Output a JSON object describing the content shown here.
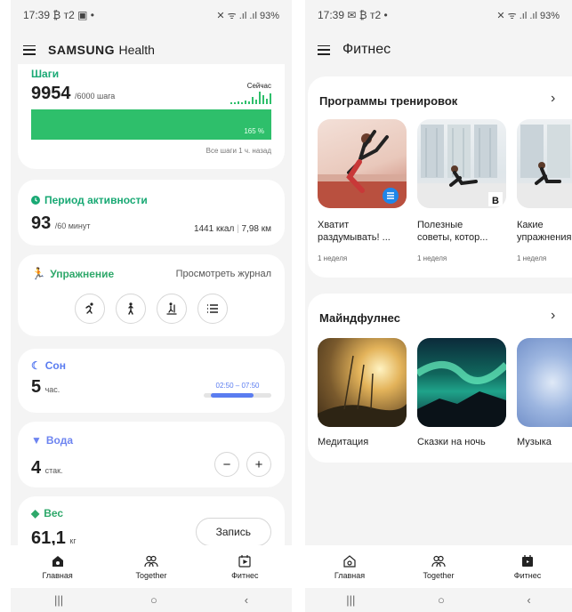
{
  "left": {
    "status": {
      "time": "17:39",
      "icons": "₿ т2 ▣ •",
      "right": "✕ ᯤ .ıl .ıl 93%"
    },
    "header": {
      "brand_bold": "SAMSUNG",
      "brand_light": "Health"
    },
    "steps": {
      "label": "Шаги",
      "value": "9954",
      "goal": "/6000 шага",
      "now_label": "Сейчас",
      "percent": "165 %",
      "footnote": "Все шаги 1 ч. назад"
    },
    "activity": {
      "label": "Период активности",
      "value": "93",
      "goal": "/60 минут",
      "kcal": "1441 ккал",
      "km": "7,98 км"
    },
    "exercise": {
      "label": "Упражнение",
      "journal": "Просмотреть журнал"
    },
    "sleep": {
      "label": "Сон",
      "value": "5",
      "unit": "час.",
      "range": "02:50 – 07:50"
    },
    "water": {
      "label": "Вода",
      "value": "4",
      "unit": "стак."
    },
    "weight": {
      "label": "Вес",
      "value": "61,1",
      "unit": "кг",
      "record": "Запись"
    },
    "nav": {
      "home": "Главная",
      "together": "Together",
      "fitness": "Фитнес"
    }
  },
  "right": {
    "status": {
      "time": "17:39",
      "icons": "✉ ₿ т2 •",
      "right": "✕ ᯤ .ıl .ıl 93%"
    },
    "header": {
      "title": "Фитнес"
    },
    "programs": {
      "title": "Программы тренировок",
      "items": [
        {
          "line1": "Хватит",
          "line2": "раздумывать! ...",
          "sub": "1 неделя"
        },
        {
          "line1": "Полезные",
          "line2": "советы, котор...",
          "sub": "1 неделя"
        },
        {
          "line1": "Какие",
          "line2": "упражнения",
          "sub": "1 неделя"
        }
      ]
    },
    "mindfulness": {
      "title": "Майндфулнес",
      "items": [
        {
          "label": "Медитация"
        },
        {
          "label": "Сказки на ночь"
        },
        {
          "label": "Музыка"
        }
      ]
    },
    "nav": {
      "home": "Главная",
      "together": "Together",
      "fitness": "Фитнес"
    }
  },
  "colors": {
    "accent_green": "#2ebf6b",
    "activity_green": "#19a974",
    "sleep_blue": "#5a7cf0",
    "background": "#f4f4f4"
  }
}
